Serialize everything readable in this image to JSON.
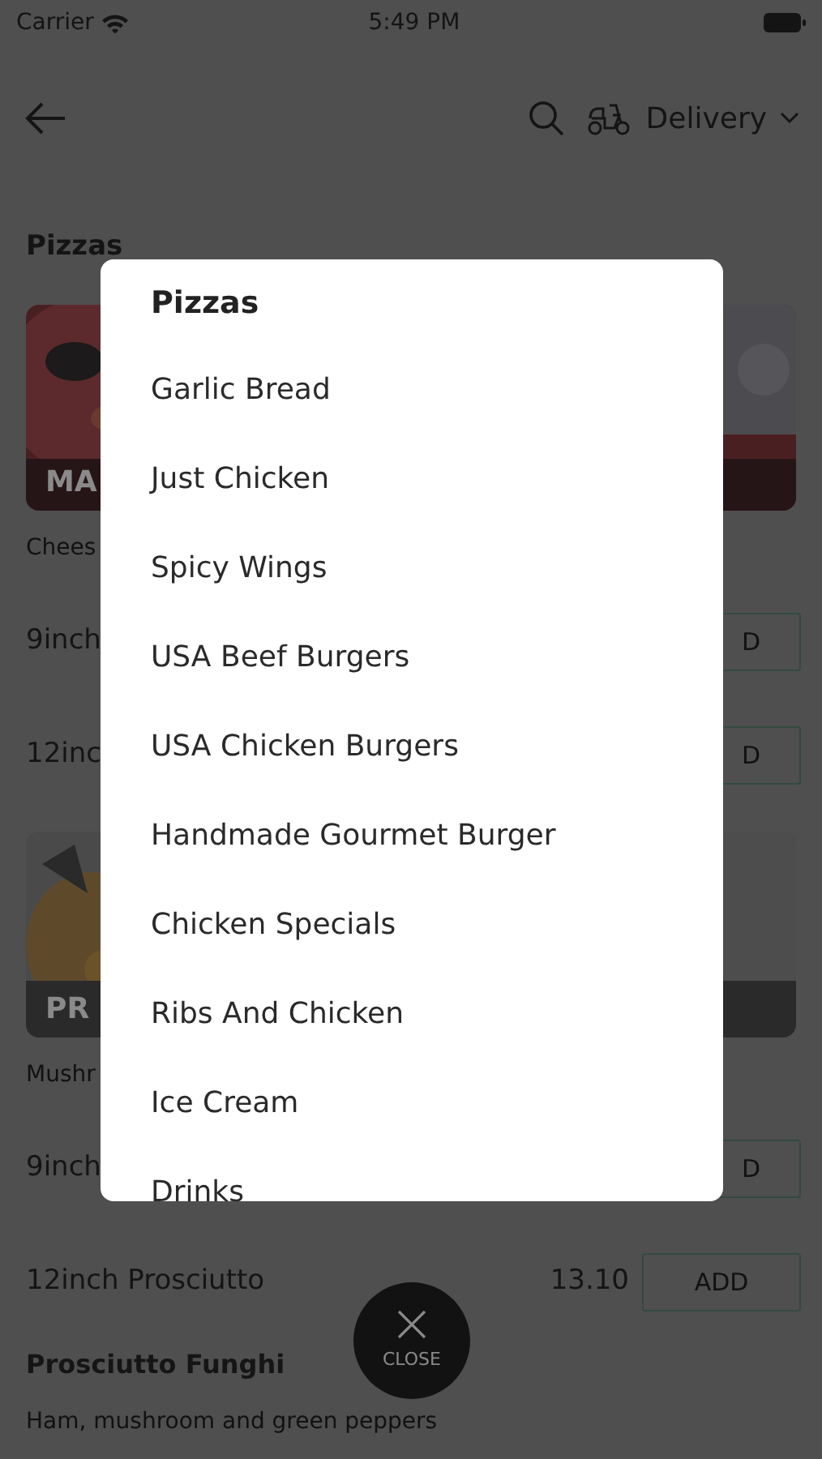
{
  "status_bar": {
    "carrier": "Carrier",
    "time": "5:49 PM"
  },
  "header": {
    "mode": "Delivery"
  },
  "section_title": "Pizzas",
  "menu_rows": [
    {
      "kind": "picture",
      "banner": "MA"
    },
    {
      "kind": "description",
      "text": "Chees"
    },
    {
      "kind": "option",
      "name": "9inch",
      "add": "D"
    },
    {
      "kind": "option",
      "name": "12inc",
      "add": "D"
    },
    {
      "kind": "picture",
      "banner": "PR"
    },
    {
      "kind": "description",
      "text": "Mushr"
    },
    {
      "kind": "option",
      "name": "9inch",
      "add": "D"
    },
    {
      "kind": "option",
      "name": "12inch Prosciutto",
      "price": "13.10",
      "add": "ADD"
    },
    {
      "kind": "title",
      "text": "Prosciutto Funghi"
    },
    {
      "kind": "description",
      "text": "Ham, mushroom and green peppers"
    }
  ],
  "category_menu": {
    "title": "Pizzas",
    "categories": [
      "Garlic Bread",
      "Just Chicken",
      "Spicy Wings",
      "USA Beef Burgers",
      "USA Chicken Burgers",
      "Handmade Gourmet Burger",
      "Chicken Specials",
      "Ribs And Chicken",
      "Ice Cream",
      "Drinks"
    ]
  },
  "close_button": {
    "label": "CLOSE"
  }
}
